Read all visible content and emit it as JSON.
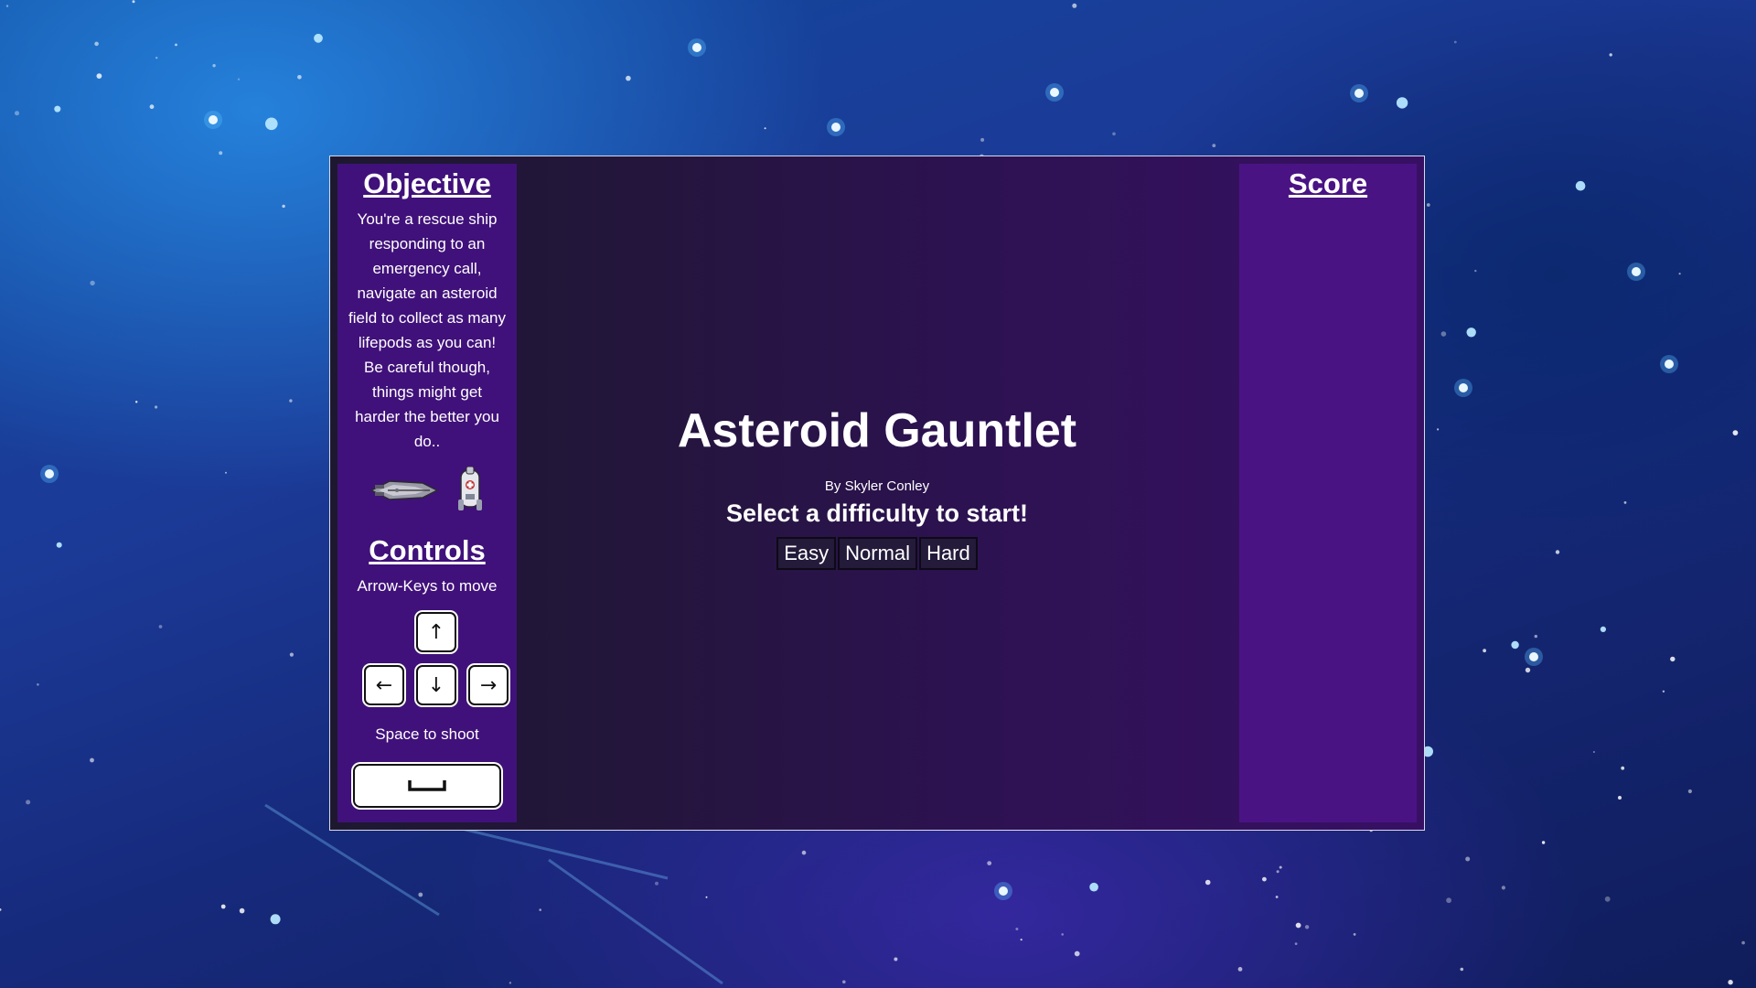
{
  "objective": {
    "heading": "Objective",
    "text": "You're a rescue ship responding to an emergency call, navigate an asteroid field to collect as many lifepods as you can! Be careful though, things might get harder the better you do.."
  },
  "controls": {
    "heading": "Controls",
    "move_hint": "Arrow-Keys to move",
    "keys": {
      "up": "↑",
      "left": "←",
      "down": "↓",
      "right": "→"
    },
    "shoot_hint": "Space to shoot"
  },
  "game": {
    "title": "Asteroid Gauntlet",
    "author": "By Skyler Conley",
    "prompt": "Select a difficulty to start!",
    "difficulties": [
      "Easy",
      "Normal",
      "Hard"
    ]
  },
  "score": {
    "heading": "Score"
  },
  "icons": [
    "ship-icon",
    "lifepod-icon",
    "space-bar-icon"
  ]
}
